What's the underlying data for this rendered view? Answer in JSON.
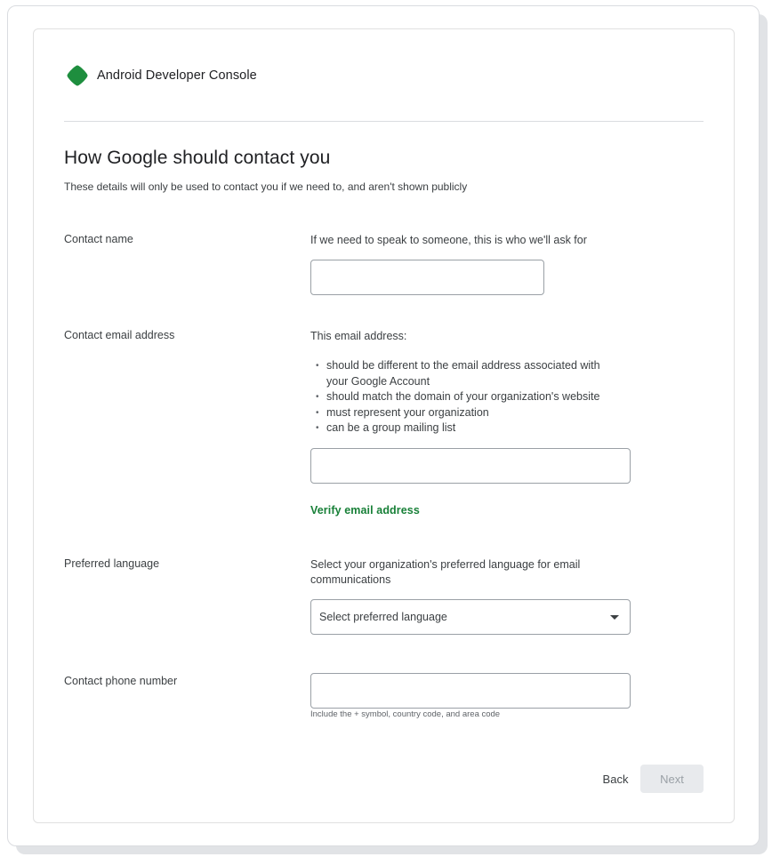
{
  "app": {
    "brand_name": "Android Developer Console",
    "logo_icon": "android-console-logo-icon",
    "brand_color": "#1e8e3e"
  },
  "page": {
    "title": "How Google should contact you",
    "subtitle": "These details will only be used to contact you if we need to, and aren't shown publicly"
  },
  "contact_name": {
    "label": "Contact name",
    "description": "If we need to speak to someone, this is who we'll ask for",
    "value": "",
    "placeholder": ""
  },
  "contact_email": {
    "label": "Contact email address",
    "description": "This email address:",
    "bullets": [
      "should be different to the email address associated with your Google Account",
      "should match the domain of your organization's website",
      "must represent your organization",
      "can be a group mailing list"
    ],
    "value": "",
    "placeholder": "",
    "verify_link": "Verify email address",
    "link_color": "#188038"
  },
  "preferred_language": {
    "label": "Preferred language",
    "description": "Select your organization's preferred language for email communications",
    "selected": "Select preferred language",
    "caret_icon": "caret-down-icon"
  },
  "contact_phone": {
    "label": "Contact phone number",
    "value": "",
    "placeholder": "",
    "helper": "Include the + symbol, country code, and area code"
  },
  "footer": {
    "back_label": "Back",
    "next_label": "Next",
    "next_disabled": true
  }
}
